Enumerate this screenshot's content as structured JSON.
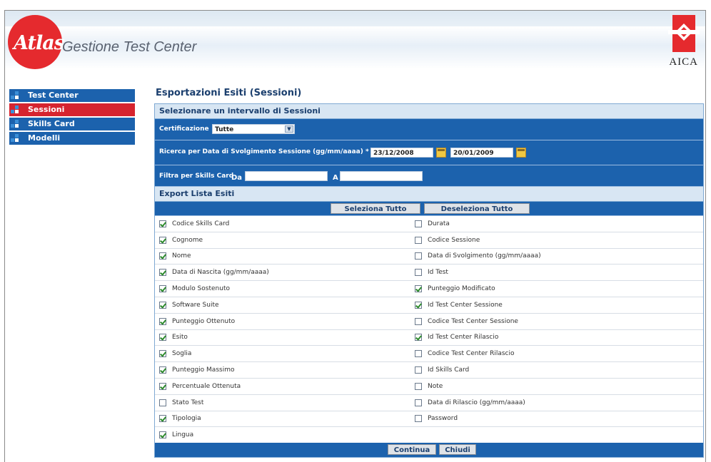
{
  "header": {
    "logo_text": "Atlas",
    "app_title": "Gestione Test Center",
    "brand_right": "AICA"
  },
  "sidebar": {
    "items": [
      {
        "label": "Test Center",
        "active": false
      },
      {
        "label": "Sessioni",
        "active": true
      },
      {
        "label": "Skills Card",
        "active": false
      },
      {
        "label": "Modelli",
        "active": false
      }
    ]
  },
  "main": {
    "page_title": "Esportazioni Esiti (Sessioni)",
    "section_interval": "Selezionare un intervallo di Sessioni",
    "certificazione": {
      "label": "Certificazione",
      "value": "Tutte"
    },
    "date_search": {
      "label": "Ricerca per Data di Svolgimento Sessione (gg/mm/aaaa) *",
      "from": "23/12/2008",
      "to": "20/01/2009"
    },
    "skills_filter": {
      "label": "Filtra per Skills Card",
      "from_label": "Da",
      "to_label": "A",
      "from": "",
      "to": ""
    },
    "section_export": "Export Lista Esiti",
    "select_all": "Seleziona Tutto",
    "deselect_all": "Deseleziona Tutto",
    "left_fields": [
      {
        "label": "Codice Skills Card",
        "checked": true
      },
      {
        "label": "Cognome",
        "checked": true
      },
      {
        "label": "Nome",
        "checked": true
      },
      {
        "label": "Data di Nascita (gg/mm/aaaa)",
        "checked": true
      },
      {
        "label": "Modulo Sostenuto",
        "checked": true
      },
      {
        "label": "Software Suite",
        "checked": true
      },
      {
        "label": "Punteggio Ottenuto",
        "checked": true
      },
      {
        "label": "Esito",
        "checked": true
      },
      {
        "label": "Soglia",
        "checked": true
      },
      {
        "label": "Punteggio Massimo",
        "checked": true
      },
      {
        "label": "Percentuale Ottenuta",
        "checked": true
      },
      {
        "label": "Stato Test",
        "checked": false
      },
      {
        "label": "Tipologia",
        "checked": true
      },
      {
        "label": "Lingua",
        "checked": true
      }
    ],
    "right_fields": [
      {
        "label": "Durata",
        "checked": false
      },
      {
        "label": "Codice Sessione",
        "checked": false
      },
      {
        "label": "Data di Svolgimento (gg/mm/aaaa)",
        "checked": false
      },
      {
        "label": "Id Test",
        "checked": false
      },
      {
        "label": "Punteggio Modificato",
        "checked": true
      },
      {
        "label": "Id Test Center Sessione",
        "checked": true
      },
      {
        "label": "Codice Test Center Sessione",
        "checked": false
      },
      {
        "label": "Id Test Center Rilascio",
        "checked": true
      },
      {
        "label": "Codice Test Center Rilascio",
        "checked": false
      },
      {
        "label": "Id Skills Card",
        "checked": false
      },
      {
        "label": "Note",
        "checked": false
      },
      {
        "label": "Data di Rilascio (gg/mm/aaaa)",
        "checked": false
      },
      {
        "label": "Password",
        "checked": false
      }
    ],
    "continue_label": "Continua",
    "close_label": "Chiudi"
  }
}
